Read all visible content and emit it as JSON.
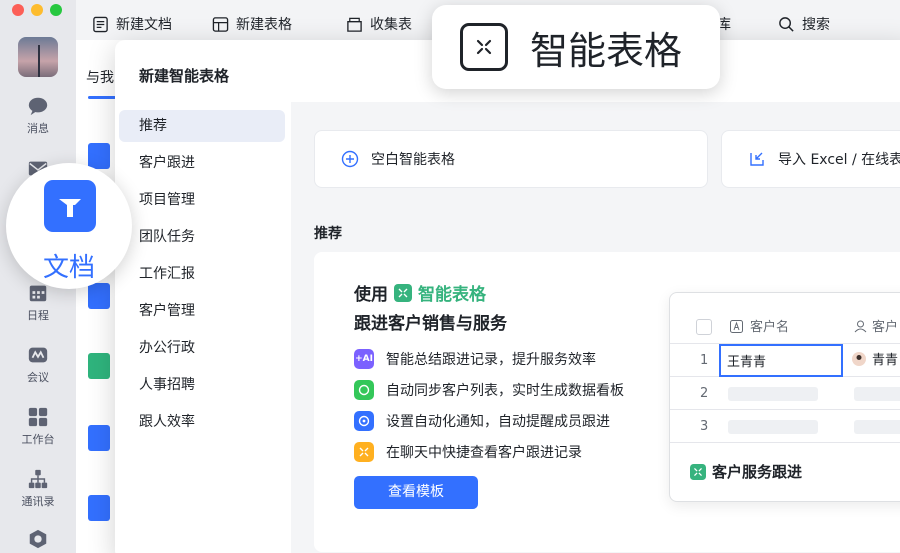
{
  "dock": {
    "items": [
      {
        "label": "消息",
        "icon": "message-icon"
      },
      {
        "label": "日程",
        "icon": "calendar-icon"
      },
      {
        "label": "会议",
        "icon": "meeting-icon"
      },
      {
        "label": "工作台",
        "icon": "workplace-icon"
      },
      {
        "label": "通讯录",
        "icon": "contacts-icon"
      }
    ]
  },
  "toolbar": {
    "new_doc": "新建文档",
    "new_sheet": "新建表格",
    "collect_form": "收集表",
    "partial_lib": "库",
    "search": "搜索"
  },
  "background": {
    "tab_label": "与我"
  },
  "modal": {
    "title": "新建智能表格",
    "sidebar": [
      "推荐",
      "客户跟进",
      "项目管理",
      "团队任务",
      "工作汇报",
      "客户管理",
      "办公行政",
      "人事招聘",
      "跟人效率"
    ],
    "blank_button": "空白智能表格",
    "import_button": "导入 Excel / 在线表",
    "recommend_label": "推荐",
    "promo": {
      "headline_prefix": "使用",
      "headline_accent": "智能表格",
      "subheadline": "跟进客户销售与服务",
      "features": [
        {
          "text": "智能总结跟进记录，提升服务效率",
          "icon": "ai-icon",
          "color": "#7b61ff",
          "badge": "+AI"
        },
        {
          "text": "自动同步客户列表，实时生成数据看板",
          "icon": "sync-icon",
          "color": "#34c759"
        },
        {
          "text": "设置自动化通知，自动提醒成员跟进",
          "icon": "notify-icon",
          "color": "#3370ff"
        },
        {
          "text": "在聊天中快捷查看客户跟进记录",
          "icon": "chat-icon",
          "color": "#ffb020"
        }
      ],
      "view_button": "查看模板",
      "preview": {
        "col1": "客户名",
        "col2": "客户",
        "rows": [
          {
            "num": "1",
            "name": "王青青",
            "owner": "青青"
          },
          {
            "num": "2",
            "name": "",
            "owner": ""
          },
          {
            "num": "3",
            "name": "",
            "owner": ""
          }
        ],
        "footer": "客户服务跟进"
      }
    }
  },
  "bubble": {
    "label": "智能表格"
  },
  "circle": {
    "label": "文档"
  },
  "colors": {
    "accent": "#3370ff",
    "green": "#36b37e"
  }
}
